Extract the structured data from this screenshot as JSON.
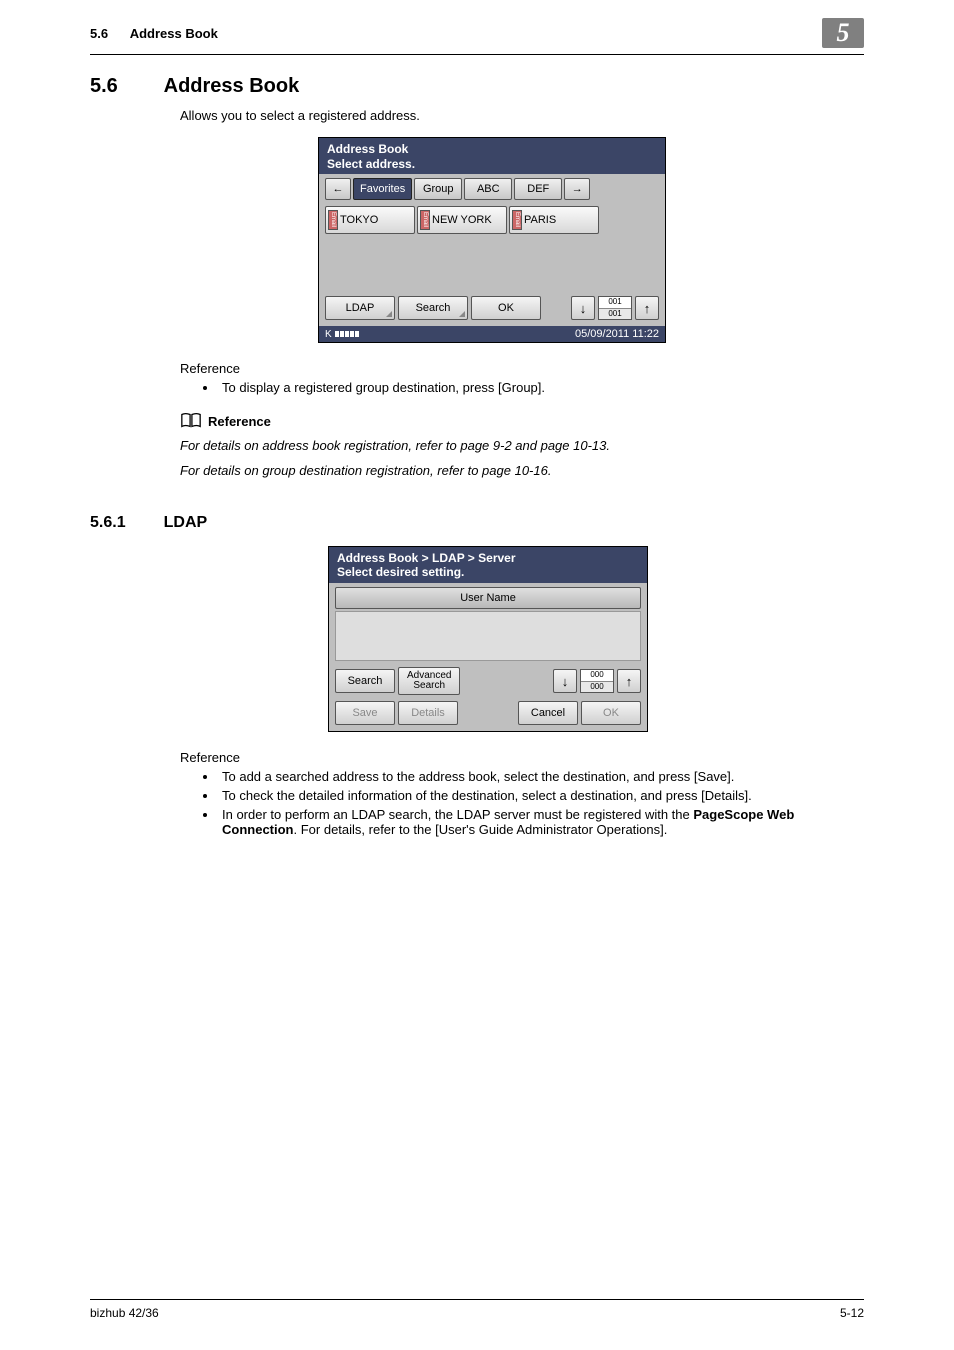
{
  "header": {
    "section_num": "5.6",
    "section_title": "Address Book",
    "chapter_badge": "5"
  },
  "h1": {
    "num": "5.6",
    "title": "Address Book"
  },
  "intro": "Allows you to select a registered address.",
  "panel1": {
    "title_line1": "Address Book",
    "title_line2": "Select address.",
    "tabs": {
      "favorites": "Favorites",
      "group": "Group",
      "abc": "ABC",
      "def": "DEF"
    },
    "addresses": {
      "a1": "TOKYO",
      "a2": "NEW YORK",
      "a3": "PARIS"
    },
    "btn_ldap": "LDAP",
    "btn_search": "Search",
    "btn_ok": "OK",
    "counter_top": "001",
    "counter_bot": "001",
    "footer_sig": "K",
    "footer_date": "05/09/2011  11:22",
    "arrow_left": "←",
    "arrow_right": "→",
    "arrow_down": "↓",
    "arrow_up": "↑"
  },
  "ref1_heading": "Reference",
  "ref1_items": {
    "i1": "To display a registered group destination, press [Group]."
  },
  "ref_label": "Reference",
  "italic1": "For details on address book registration, refer to page 9-2 and page 10-13.",
  "italic2": "For details on group destination registration, refer to page 10-16.",
  "h2": {
    "num": "5.6.1",
    "title": "LDAP"
  },
  "panel2": {
    "breadcrumb": "Address Book > LDAP > Server",
    "instruction": "Select desired setting.",
    "col_header": "User Name",
    "btn_search": "Search",
    "btn_adv_top": "Advanced",
    "btn_adv_bot": "Search",
    "counter_top": "000",
    "counter_bot": "000",
    "btn_save": "Save",
    "btn_details": "Details",
    "btn_cancel": "Cancel",
    "btn_ok": "OK",
    "arrow_down": "↓",
    "arrow_up": "↑"
  },
  "ref2_heading": "Reference",
  "ref2_items": {
    "i1": "To add a searched address to the address book, select the destination, and press [Save].",
    "i2": "To check the detailed information of the destination, select a destination, and press [Details].",
    "i3_a": "In order to perform an LDAP search, the LDAP server must be registered with the ",
    "i3_b": "PageScope Web Connection",
    "i3_c": ". For details, refer to the [User's Guide Administrator Operations]."
  },
  "footer": {
    "left": "bizhub 42/36",
    "right": "5-12"
  }
}
